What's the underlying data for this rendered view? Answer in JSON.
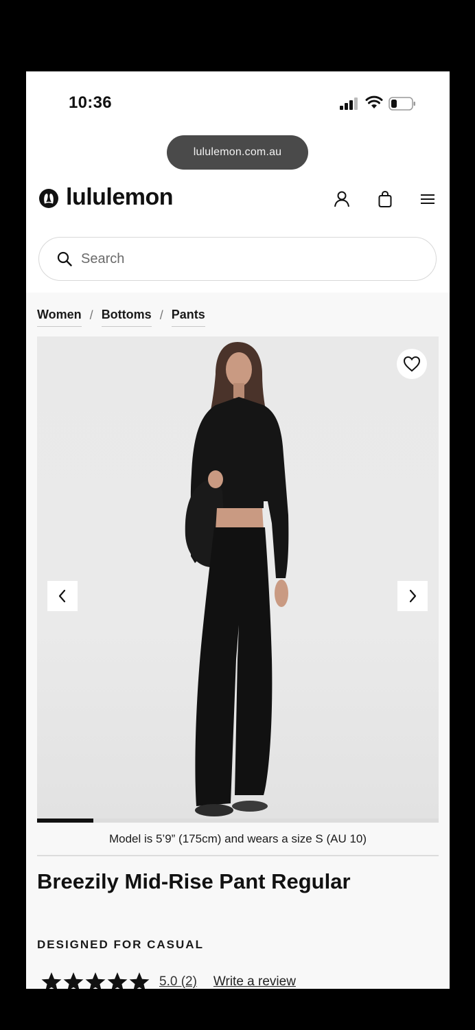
{
  "status_bar": {
    "time": "10:36"
  },
  "browser": {
    "url": "lululemon.com.au"
  },
  "header": {
    "brand": "lululemon"
  },
  "search": {
    "placeholder": "Search"
  },
  "breadcrumb": [
    {
      "label": "Women"
    },
    {
      "label": "Bottoms"
    },
    {
      "label": "Pants"
    }
  ],
  "breadcrumb_separator": "/",
  "gallery": {
    "progress": 0.14
  },
  "product": {
    "model_info": "Model is 5’9” (175cm) and wears a size S (AU 10)",
    "title": "Breezily Mid-Rise Pant Regular",
    "designed_for": "DESIGNED FOR CASUAL",
    "rating": "5.0 (2)",
    "rating_stars": 5,
    "review_link": "Write a review"
  },
  "icons": {
    "account": "account-icon",
    "bag": "shopping-bag-icon",
    "menu": "hamburger-menu-icon",
    "search": "search-icon",
    "wishlist": "heart-icon",
    "prev": "chevron-left-icon",
    "next": "chevron-right-icon"
  },
  "colors": {
    "text": "#111111",
    "url_pill": "#4a4a4a",
    "image_bg": "#e9e9e9"
  }
}
